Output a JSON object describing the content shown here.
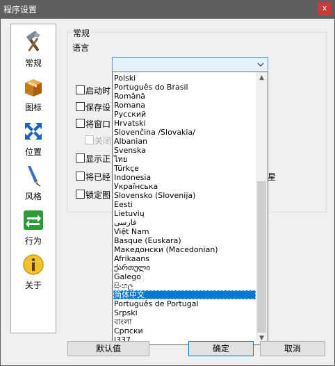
{
  "window": {
    "title": "程序设置",
    "close_glyph": "x"
  },
  "nav": {
    "items": [
      {
        "label": "常规",
        "icon": "tools-icon"
      },
      {
        "label": "图标",
        "icon": "package-icon"
      },
      {
        "label": "位置",
        "icon": "move-arrows-icon"
      },
      {
        "label": "风格",
        "icon": "pen-nib-icon"
      },
      {
        "label": "行为",
        "icon": "swap-arrows-icon"
      },
      {
        "label": "关于",
        "icon": "info-icon"
      }
    ]
  },
  "general": {
    "group_title": "常规",
    "language_label": "语言",
    "language_value": "",
    "checkboxes": [
      {
        "text": "启动时",
        "checked": false,
        "enabled": true
      },
      {
        "text": "保存设",
        "checked": false,
        "enabled": true
      },
      {
        "text": "将窗口",
        "checked": false,
        "enabled": true
      },
      {
        "text": "关闭",
        "checked": false,
        "enabled": false
      },
      {
        "text": "显示正",
        "checked": false,
        "enabled": true
      },
      {
        "text": "将已经",
        "checked": false,
        "enabled": true
      },
      {
        "text": "锁定图",
        "checked": false,
        "enabled": true
      }
    ],
    "right_fragment": "星"
  },
  "language_dropdown": {
    "options": [
      "Polski",
      "Português do Brasil",
      "Română",
      "Romana",
      "Русский",
      "Hrvatski",
      "Slovenčina /Slovakia/",
      "Albanian",
      "Svenska",
      "ไทย",
      "Türkçe",
      "Indonesia",
      "Українська",
      "Slovensko (Slovenija)",
      "Eesti",
      "Lietuvių",
      "فارسی",
      "Việt Nam",
      "Basque (Euskara)",
      "Македонски (Macedonian)",
      "Afrikaans",
      "ქართული",
      "Galego",
      "සිංහල",
      "简体中文",
      "Português de Portugal",
      "Srpski",
      "বাংলা",
      "Српски",
      "l337"
    ],
    "selected": "简体中文",
    "scroll_up": "▲",
    "scroll_down": "▼"
  },
  "buttons": {
    "default_label": "默认值",
    "ok_label": "确定",
    "cancel_label": "取消"
  },
  "colors": {
    "titlebar": "#5f5f5f",
    "close": "#c93a3a",
    "selection": "#0078d7",
    "combo_focus": "#569de5"
  }
}
